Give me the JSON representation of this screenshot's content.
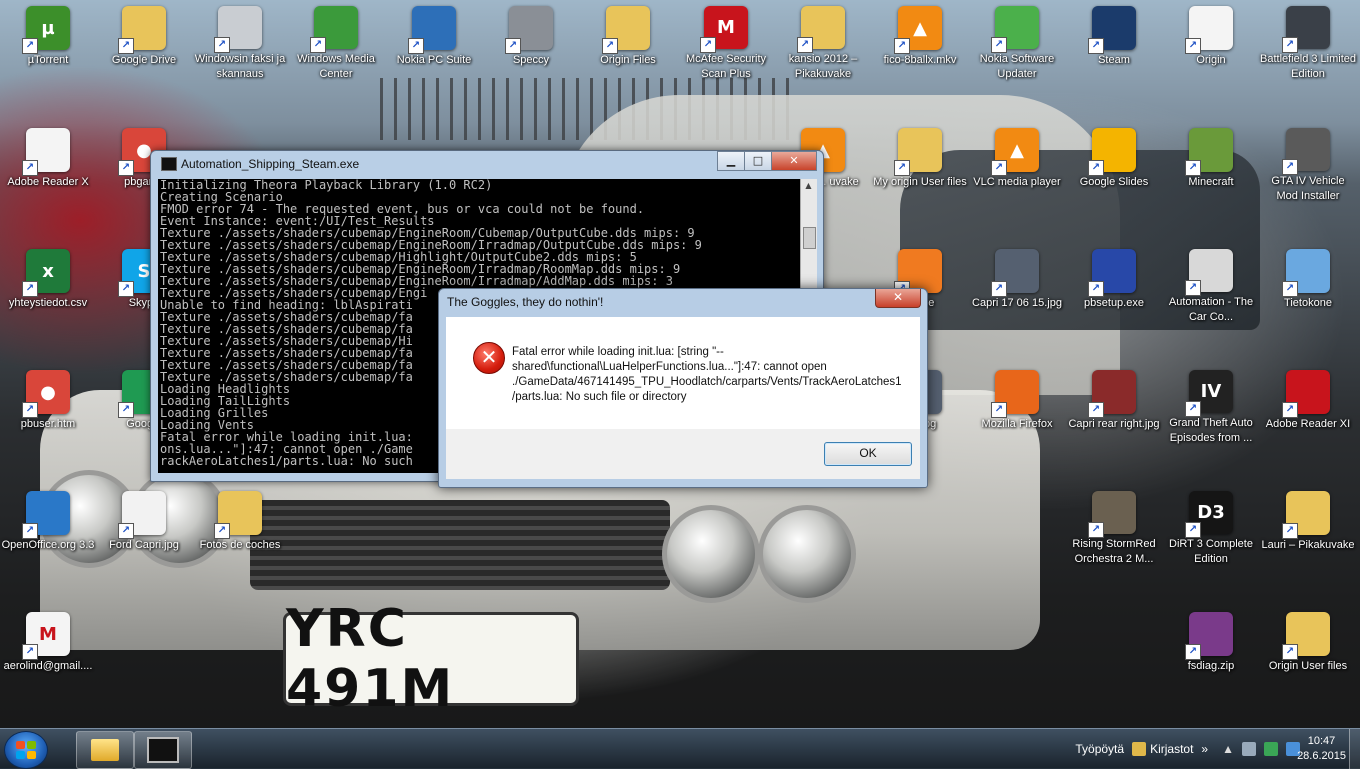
{
  "wallpaper": {
    "plate_text": "YRC 491M"
  },
  "desktop_icons": [
    {
      "label": "µTorrent",
      "icon": "utorrent-icon",
      "color": "#3c8f2a",
      "glyph": "µ"
    },
    {
      "label": "Google Drive",
      "icon": "folder-icon",
      "color": "#e8c45a",
      "glyph": ""
    },
    {
      "label": "Windowsin faksi ja skannaus",
      "icon": "fax-icon",
      "color": "#c9cdd2",
      "glyph": ""
    },
    {
      "label": "Windows Media Center",
      "icon": "media-center-icon",
      "color": "#3b9a3b",
      "glyph": ""
    },
    {
      "label": "Nokia PC Suite",
      "icon": "nokia-icon",
      "color": "#2d6fb8",
      "glyph": ""
    },
    {
      "label": "Speccy",
      "icon": "speccy-icon",
      "color": "#8a8f96",
      "glyph": ""
    },
    {
      "label": "Origin Files",
      "icon": "folder-icon",
      "color": "#e8c45a",
      "glyph": ""
    },
    {
      "label": "McAfee Security Scan Plus",
      "icon": "mcafee-icon",
      "color": "#c8141c",
      "glyph": "M"
    },
    {
      "label": "kansio 2012 – Pikakuvake",
      "icon": "folder-icon",
      "color": "#e8c45a",
      "glyph": ""
    },
    {
      "label": "fico-8ballx.mkv",
      "icon": "vlc-icon",
      "color": "#f28a12",
      "glyph": "▲"
    },
    {
      "label": "Nokia Software Updater",
      "icon": "nokia-updater-icon",
      "color": "#4bb04b",
      "glyph": ""
    },
    {
      "label": "Steam",
      "icon": "steam-icon",
      "color": "#1b3b6b",
      "glyph": ""
    },
    {
      "label": "Origin",
      "icon": "document-icon",
      "color": "#f4f4f4",
      "glyph": ""
    },
    {
      "label": "Battlefield 3 Limited Edition",
      "icon": "battlefield-icon",
      "color": "#3a4048",
      "glyph": ""
    },
    {
      "label": "Adobe Reader X",
      "icon": "document-icon",
      "color": "#f4f4f4",
      "glyph": ""
    },
    {
      "label": "pbgame",
      "icon": "chrome-icon",
      "color": "#d9463a",
      "glyph": "●"
    },
    {
      "label": "wtte-7... uvake",
      "icon": "vlc-icon",
      "color": "#f28a12",
      "glyph": "▲"
    },
    {
      "label": "My origin User files",
      "icon": "folder-icon",
      "color": "#e8c45a",
      "glyph": ""
    },
    {
      "label": "VLC media player",
      "icon": "vlc-icon",
      "color": "#f28a12",
      "glyph": "▲"
    },
    {
      "label": "Google Slides",
      "icon": "slides-icon",
      "color": "#f4b400",
      "glyph": ""
    },
    {
      "label": "Minecraft",
      "icon": "minecraft-icon",
      "color": "#6a9a3a",
      "glyph": ""
    },
    {
      "label": "GTA IV Vehicle Mod Installer",
      "icon": "gta-installer-icon",
      "color": "#5a5a5a",
      "glyph": ""
    },
    {
      "label": "yhteystiedot.csv",
      "icon": "excel-icon",
      "color": "#1f7a3a",
      "glyph": "x"
    },
    {
      "label": "Skype",
      "icon": "skype-icon",
      "color": "#10a5e8",
      "glyph": "S"
    },
    {
      "label": "s Live",
      "icon": "mail-icon",
      "color": "#f07a20",
      "glyph": ""
    },
    {
      "label": "Capri 17 06 15.jpg",
      "icon": "image-icon",
      "color": "#556070",
      "glyph": ""
    },
    {
      "label": "pbsetup.exe",
      "icon": "pbsetup-icon",
      "color": "#2848a8",
      "glyph": ""
    },
    {
      "label": "Automation - The Car Co...",
      "icon": "automation-icon",
      "color": "#d8d8d8",
      "glyph": ""
    },
    {
      "label": "Tietokone",
      "icon": "computer-icon",
      "color": "#6aa8e0",
      "glyph": ""
    },
    {
      "label": "pbuser.htm",
      "icon": "chrome-icon",
      "color": "#d9463a",
      "glyph": "●"
    },
    {
      "label": "Google",
      "icon": "sheets-icon",
      "color": "#1f9a52",
      "glyph": ""
    },
    {
      "label": "left.jpg",
      "icon": "image-icon",
      "color": "#556070",
      "glyph": ""
    },
    {
      "label": "Mozilla Firefox",
      "icon": "firefox-icon",
      "color": "#e8661a",
      "glyph": ""
    },
    {
      "label": "Capri rear right.jpg",
      "icon": "image-icon",
      "color": "#8a2a2a",
      "glyph": ""
    },
    {
      "label": "Grand Theft Auto Episodes from ...",
      "icon": "gta-icon",
      "color": "#222222",
      "glyph": "IV"
    },
    {
      "label": "Adobe Reader XI",
      "icon": "adobe-icon",
      "color": "#c8141c",
      "glyph": ""
    },
    {
      "label": "OpenOffice.org 3.3",
      "icon": "openoffice-icon",
      "color": "#2a78c8",
      "glyph": ""
    },
    {
      "label": "Ford Capri.jpg",
      "icon": "image-icon",
      "color": "#f2f2f2",
      "glyph": ""
    },
    {
      "label": "Fotos de coches",
      "icon": "folder-icon",
      "color": "#e8c45a",
      "glyph": ""
    },
    {
      "label": "Rising StormRed Orchestra 2 M...",
      "icon": "rising-storm-icon",
      "color": "#6a6050",
      "glyph": ""
    },
    {
      "label": "DiRT 3 Complete Edition",
      "icon": "dirt3-icon",
      "color": "#151515",
      "glyph": "D3"
    },
    {
      "label": "Lauri – Pikakuvake",
      "icon": "folder-icon",
      "color": "#e8c45a",
      "glyph": ""
    },
    {
      "label": "aerolind@gmail....",
      "icon": "gmail-icon",
      "color": "#f4f4f4",
      "glyph": "M"
    },
    {
      "label": "fsdiag.zip",
      "icon": "winrar-icon",
      "color": "#7a3a8a",
      "glyph": ""
    },
    {
      "label": "Origin User files",
      "icon": "folder-icon",
      "color": "#e8c45a",
      "glyph": ""
    }
  ],
  "console": {
    "title": "Automation_Shipping_Steam.exe",
    "lines": [
      "Initializing Theora Playback Library (1.0 RC2)",
      "Creating Scenario",
      "FMOD error 74 - The requested event, bus or vca could not be found.",
      "Event Instance: event:/UI/Test_Results",
      "Texture ./assets/shaders/cubemap/EngineRoom/Cubemap/OutputCube.dds mips: 9",
      "Texture ./assets/shaders/cubemap/EngineRoom/Irradmap/OutputCube.dds mips: 9",
      "Texture ./assets/shaders/cubemap/Highlight/OutputCube2.dds mips: 5",
      "Texture ./assets/shaders/cubemap/EngineRoom/Irradmap/RoomMap.dds mips: 9",
      "Texture ./assets/shaders/cubemap/EngineRoom/Irradmap/AddMap.dds mips: 3",
      "Texture ./assets/shaders/cubemap/Engi",
      "Unable to find heading: lblAspirati",
      "Texture ./assets/shaders/cubemap/fa",
      "Texture ./assets/shaders/cubemap/fa",
      "Texture ./assets/shaders/cubemap/Hi",
      "Texture ./assets/shaders/cubemap/fa",
      "Texture ./assets/shaders/cubemap/fa",
      "Texture ./assets/shaders/cubemap/fa",
      "Loading Headlights",
      "Loading TailLights",
      "Loading Grilles",
      "Loading Vents",
      "Fatal error while loading init.lua:",
      "ons.lua...\"]:47: cannot open ./Game",
      "rackAeroLatches1/parts.lua: No such"
    ],
    "btn_minimize": "▁",
    "btn_maximize": "□",
    "btn_close": "✕"
  },
  "dialog": {
    "title": "The Goggles, they do nothin'!",
    "message": "Fatal error while loading init.lua: [string \"--shared\\functional\\LuaHelperFunctions.lua...\"]:47: cannot open ./GameData/467141495_TPU_Hoodlatch/carparts/Vents/TrackAeroLatches1/parts.lua: No such file or directory",
    "ok_label": "OK",
    "close_label": "✕",
    "error_glyph": "✕"
  },
  "taskbar": {
    "toolbar_desktop": "Työpöytä",
    "toolbar_libraries": "Kirjastot",
    "expand": "»",
    "time": "10:47",
    "date": "28.6.2015"
  }
}
